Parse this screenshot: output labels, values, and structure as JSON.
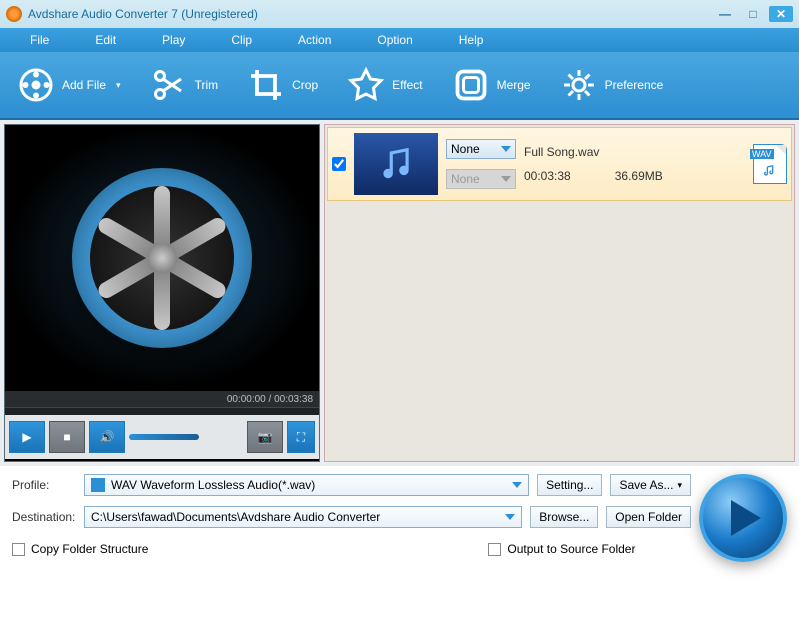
{
  "title": "Avdshare Audio Converter 7 (Unregistered)",
  "menu": [
    "File",
    "Edit",
    "Play",
    "Clip",
    "Action",
    "Option",
    "Help"
  ],
  "toolbar": [
    {
      "label": "Add File",
      "icon": "reel"
    },
    {
      "label": "Trim",
      "icon": "scissors"
    },
    {
      "label": "Crop",
      "icon": "crop"
    },
    {
      "label": "Effect",
      "icon": "star"
    },
    {
      "label": "Merge",
      "icon": "merge"
    },
    {
      "label": "Preference",
      "icon": "gear"
    }
  ],
  "preview": {
    "time": "00:00:00 / 00:03:38"
  },
  "file": {
    "name": "Full Song.wav",
    "duration": "00:03:38",
    "size": "36.69MB",
    "format": "WAV",
    "sel1": "None",
    "sel2": "None",
    "checked": true
  },
  "profile": {
    "label": "Profile:",
    "value": "WAV Waveform Lossless Audio(*.wav)",
    "setting": "Setting...",
    "saveas": "Save As..."
  },
  "destination": {
    "label": "Destination:",
    "value": "C:\\Users\\fawad\\Documents\\Avdshare Audio Converter",
    "browse": "Browse...",
    "open": "Open Folder"
  },
  "checks": {
    "copy": "Copy Folder Structure",
    "output": "Output to Source Folder"
  }
}
